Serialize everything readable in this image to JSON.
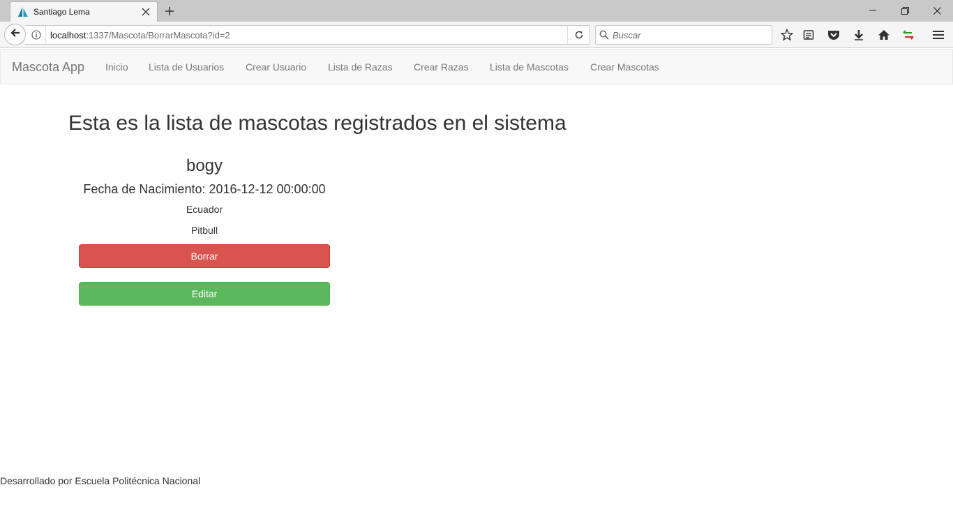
{
  "browser": {
    "tab_title": "Santiago Lema",
    "url_host": "localhost",
    "url_path": ":1337/Mascota/BorrarMascota?id=2",
    "search_placeholder": "Buscar",
    "icons": [
      "back-arrow-icon",
      "info-icon",
      "reload-icon",
      "search-icon",
      "star-icon",
      "reading-list-icon",
      "pocket-icon",
      "download-icon",
      "home-icon",
      "sync-icon",
      "menu-icon"
    ]
  },
  "app_nav": {
    "brand": "Mascota App",
    "links": [
      "Inicio",
      "Lista de Usuarios",
      "Crear Usuario",
      "Lista de Razas",
      "Crear Razas",
      "Lista de Mascotas",
      "Crear Mascotas"
    ]
  },
  "main": {
    "heading": "Esta es la lista de mascotas registrados en el sistema",
    "pet": {
      "name": "bogy",
      "birth": "Fecha de Nacimiento: 2016-12-12 00:00:00",
      "country": "Ecuador",
      "breed": "Pitbull",
      "delete_label": "Borrar",
      "edit_label": "Editar"
    }
  },
  "footer": {
    "text": "Desarrollado por Escuela Politécnica Nacional"
  },
  "colors": {
    "danger": "#d9534f",
    "success": "#5cb85c",
    "navbar_bg": "#f8f8f8"
  }
}
